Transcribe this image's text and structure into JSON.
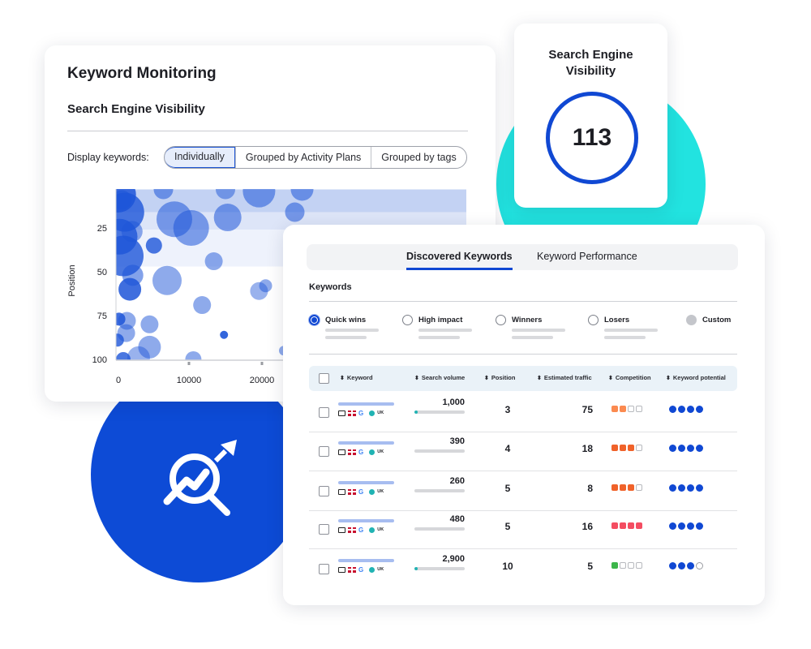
{
  "colors": {
    "brand_blue": "#1048d3",
    "teal": "#22e3e0",
    "bubble": "#1d55d8",
    "volume_bar": "#20b3b3",
    "comp_orange_light": "#fb8a50",
    "comp_orange": "#f0622a",
    "comp_red": "#f44d61",
    "comp_green": "#3cb54a",
    "potential_dot": "#1048d3"
  },
  "keyword_monitoring": {
    "title": "Keyword Monitoring",
    "subtitle": "Search Engine Visibility",
    "display_label": "Display keywords:",
    "display_options": [
      "Individually",
      "Grouped by Activity Plans",
      "Grouped by tags"
    ],
    "display_selected": "Individually"
  },
  "chart_data": {
    "type": "scatter",
    "subtype": "bubble",
    "title": "Search Engine Visibility",
    "xlabel": "",
    "ylabel": "Position",
    "x_ticks": [
      "0",
      "10000",
      "20000"
    ],
    "y_ticks": [
      "25",
      "50",
      "75",
      "100"
    ],
    "xlim": [
      0,
      25000
    ],
    "ylim": [
      100,
      3
    ],
    "y_inverted": true,
    "bands": [
      {
        "from": 3,
        "to": 16,
        "level": "dark"
      },
      {
        "from": 16,
        "to": 26,
        "level": "medium"
      },
      {
        "from": 26,
        "to": 47,
        "level": "light"
      }
    ],
    "points": [
      {
        "x": 300,
        "y": 6,
        "size": 22,
        "opacity": 0.85
      },
      {
        "x": 1200,
        "y": 16,
        "size": 24,
        "opacity": 0.8
      },
      {
        "x": 500,
        "y": 30,
        "size": 22,
        "opacity": 0.8
      },
      {
        "x": 1000,
        "y": 41,
        "size": 25,
        "opacity": 0.8
      },
      {
        "x": 800,
        "y": 9,
        "size": 12,
        "opacity": 0.6
      },
      {
        "x": 2200,
        "y": 27,
        "size": 13,
        "opacity": 0.5
      },
      {
        "x": 5200,
        "y": 35,
        "size": 10,
        "opacity": 0.8
      },
      {
        "x": 2300,
        "y": 52,
        "size": 13,
        "opacity": 0.55
      },
      {
        "x": 1900,
        "y": 60,
        "size": 14,
        "opacity": 0.85
      },
      {
        "x": 7000,
        "y": 55,
        "size": 18,
        "opacity": 0.5
      },
      {
        "x": 8000,
        "y": 20,
        "size": 22,
        "opacity": 0.55
      },
      {
        "x": 10300,
        "y": 25,
        "size": 22,
        "opacity": 0.55
      },
      {
        "x": 15300,
        "y": 19,
        "size": 17,
        "opacity": 0.55
      },
      {
        "x": 13400,
        "y": 44,
        "size": 11,
        "opacity": 0.5
      },
      {
        "x": 11800,
        "y": 69,
        "size": 11,
        "opacity": 0.5
      },
      {
        "x": 19600,
        "y": 61,
        "size": 11,
        "opacity": 0.45
      },
      {
        "x": 19600,
        "y": 4,
        "size": 20,
        "opacity": 0.55
      },
      {
        "x": 6500,
        "y": 3,
        "size": 12,
        "opacity": 0.55
      },
      {
        "x": 400,
        "y": 77,
        "size": 8,
        "opacity": 0.85
      },
      {
        "x": 1500,
        "y": 78,
        "size": 11,
        "opacity": 0.5
      },
      {
        "x": 1400,
        "y": 85,
        "size": 11,
        "opacity": 0.5
      },
      {
        "x": 4600,
        "y": 80,
        "size": 11,
        "opacity": 0.5
      },
      {
        "x": 200,
        "y": 89,
        "size": 8,
        "opacity": 0.8
      },
      {
        "x": 14800,
        "y": 86,
        "size": 5,
        "opacity": 0.9
      },
      {
        "x": 4600,
        "y": 93,
        "size": 14,
        "opacity": 0.5
      },
      {
        "x": 3100,
        "y": 99,
        "size": 14,
        "opacity": 0.45
      },
      {
        "x": 1000,
        "y": 100,
        "size": 9,
        "opacity": 0.8
      },
      {
        "x": 10600,
        "y": 100,
        "size": 10,
        "opacity": 0.5
      },
      {
        "x": 15000,
        "y": 3,
        "size": 12,
        "opacity": 0.5
      },
      {
        "x": 24500,
        "y": 16,
        "size": 12,
        "opacity": 0.55
      },
      {
        "x": 23000,
        "y": 95,
        "size": 6,
        "opacity": 0.5
      },
      {
        "x": 20500,
        "y": 58,
        "size": 8,
        "opacity": 0.5
      },
      {
        "x": 25500,
        "y": 3,
        "size": 14,
        "opacity": 0.55
      }
    ]
  },
  "visibility_card": {
    "title": "Search Engine Visibility",
    "value": "113"
  },
  "discovered": {
    "tabs": [
      {
        "label": "Discovered Keywords",
        "active": true
      },
      {
        "label": "Keyword Performance",
        "active": false
      }
    ],
    "section_label": "Keywords",
    "filters": [
      {
        "label": "Quick wins",
        "state": "checked"
      },
      {
        "label": "High impact",
        "state": "unchecked"
      },
      {
        "label": "Winners",
        "state": "unchecked"
      },
      {
        "label": "Losers",
        "state": "unchecked"
      },
      {
        "label": "Custom",
        "state": "filled"
      }
    ],
    "columns": [
      "Keyword",
      "Search volume",
      "Position",
      "Estimated traffic",
      "Competition",
      "Keyword potential"
    ],
    "rows": [
      {
        "search_volume": "1,000",
        "volume_fill": 0.05,
        "position": "3",
        "traffic": "75",
        "competition": 2,
        "competition_color": "#fb8a50",
        "potential": 4,
        "locale": "UK"
      },
      {
        "search_volume": "390",
        "volume_fill": 0,
        "position": "4",
        "traffic": "18",
        "competition": 3,
        "competition_color": "#f0622a",
        "potential": 4,
        "locale": "UK"
      },
      {
        "search_volume": "260",
        "volume_fill": 0,
        "position": "5",
        "traffic": "8",
        "competition": 3,
        "competition_color": "#f0622a",
        "potential": 4,
        "locale": "UK"
      },
      {
        "search_volume": "480",
        "volume_fill": 0,
        "position": "5",
        "traffic": "16",
        "competition": 4,
        "competition_color": "#f44d61",
        "potential": 4,
        "locale": "UK"
      },
      {
        "search_volume": "2,900",
        "volume_fill": 0.07,
        "position": "10",
        "traffic": "5",
        "competition": 1,
        "competition_color": "#3cb54a",
        "potential": 3,
        "locale": "UK"
      }
    ]
  }
}
